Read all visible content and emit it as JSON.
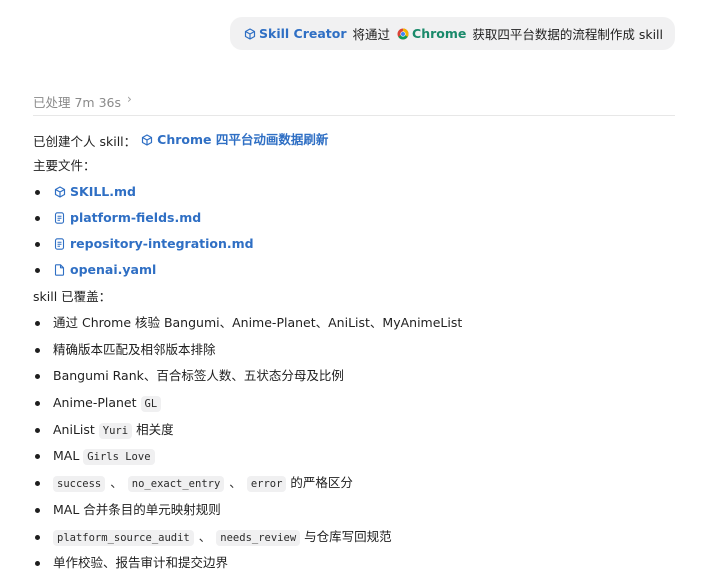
{
  "user_message": {
    "chip_skill": "Skill Creator",
    "text_1": "将通过",
    "chip_chrome": "Chrome",
    "text_2": "获取四平台数据的流程制作成 skill"
  },
  "processed": {
    "label": "已处理 7m 36s"
  },
  "created": {
    "prefix": "已创建个人 skill：",
    "skill_name": "Chrome 四平台动画数据刷新"
  },
  "files_heading": "主要文件：",
  "files": [
    {
      "name": "SKILL.md",
      "icon": "skill-icon"
    },
    {
      "name": "platform-fields.md",
      "icon": "doc-icon"
    },
    {
      "name": "repository-integration.md",
      "icon": "doc-icon"
    },
    {
      "name": "openai.yaml",
      "icon": "file-icon"
    }
  ],
  "coverage_heading": "skill 已覆盖：",
  "coverage": {
    "i1": "通过 Chrome 核验 Bangumi、Anime-Planet、AniList、MyAnimeList",
    "i2": "精确版本匹配及相邻版本排除",
    "i3": "Bangumi Rank、百合标签人数、五状态分母及比例",
    "i4_text": "Anime-Planet",
    "i4_code": "GL",
    "i5_text": "AniList",
    "i5_code": "Yuri",
    "i5_suffix": "相关度",
    "i6_text": "MAL",
    "i6_code": "Girls Love",
    "i7_code1": "success",
    "i7_sep1": "、",
    "i7_code2": "no_exact_entry",
    "i7_sep2": "、",
    "i7_code3": "error",
    "i7_suffix": "的严格区分",
    "i8": "MAL 合并条目的单元映射规则",
    "i9_code1": "platform_source_audit",
    "i9_sep": "、",
    "i9_code2": "needs_review",
    "i9_suffix": "与仓库写回规范",
    "i10": "单作校验、报告审计和提交边界"
  },
  "colors": {
    "link": "#2f6fc4",
    "chrome_chip": "#1a8a6b",
    "bubble_bg": "#f1f1f2"
  }
}
